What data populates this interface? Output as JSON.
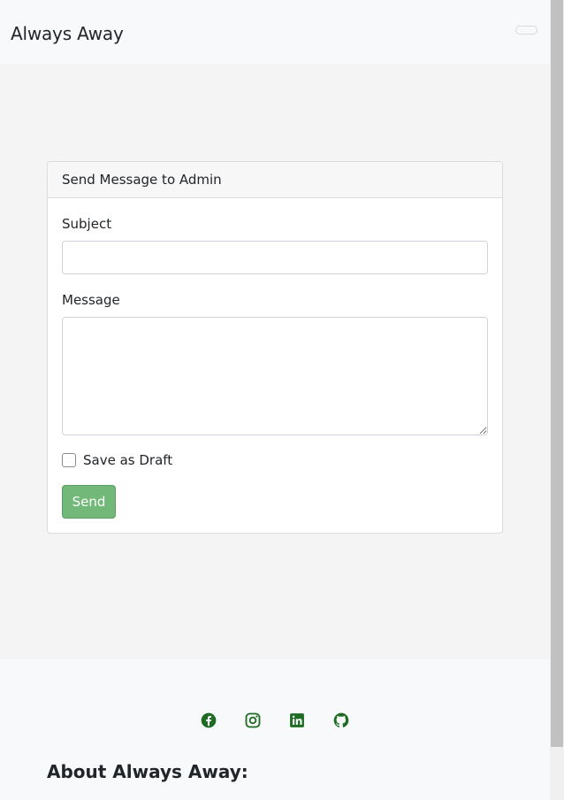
{
  "navbar": {
    "brand": "Always Away"
  },
  "form": {
    "header": "Send Message to Admin",
    "subject_label": "Subject",
    "subject_value": "",
    "message_label": "Message",
    "message_value": "",
    "draft_label": "Save as Draft",
    "draft_checked": false,
    "send_label": "Send"
  },
  "footer": {
    "social_icons": [
      "facebook-icon",
      "instagram-icon",
      "linkedin-icon",
      "github-icon"
    ],
    "icon_color": "#1e6b23",
    "about_heading": "About Always Away:"
  },
  "colors": {
    "accent": "#71b879",
    "icon": "#1e6b23"
  }
}
